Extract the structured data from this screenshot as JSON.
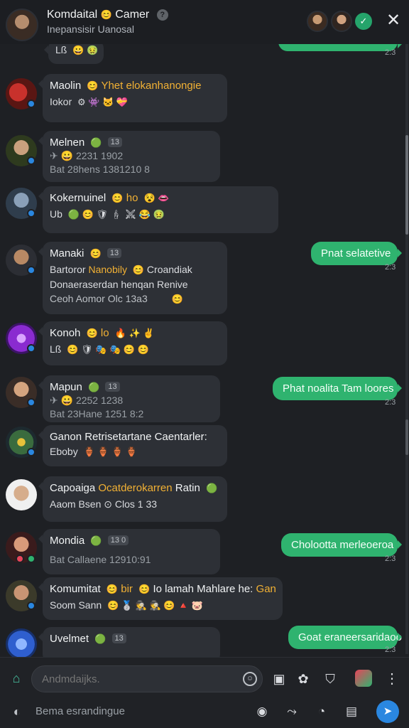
{
  "header": {
    "title": "Komdaital",
    "title_suffix": "Camer",
    "title_emoji": "😊",
    "help_glyph": "?",
    "subtitle": "Inepansisir Uanosal",
    "verified_glyph": "✓",
    "close_glyph": "✕"
  },
  "messages": [
    {
      "name": "",
      "lines": [
        "Lß"
      ],
      "emojis": "😀 🤢"
    },
    {
      "name": "Maolin",
      "highlight": "Yhet elokanhanongie",
      "name_emoji": "😊",
      "lines": [
        "Iokor"
      ],
      "emojis": "⚙ 👾 🐱 💝"
    },
    {
      "name": "Melnen",
      "chip": "13",
      "name_emoji": "🟢",
      "lines": [
        "✈ 😀 2231 1902",
        "Bat 28hens 1381210 8"
      ]
    },
    {
      "name": "Kokernuinel",
      "highlight": "ho",
      "name_emoji": "😊",
      "name_emoji2": "😵 👄",
      "lines": [
        "Ub"
      ],
      "emojis": "🟢 😊 🛡 🕯 ⚔ 😂 🤢"
    },
    {
      "name": "Manaki",
      "chip": "13",
      "name_emoji": "😊",
      "lines": [
        "Bartoror",
        "Donaeraserdan henqan Renive",
        "Ceoh Aomor Olc 13a3"
      ],
      "line1_mid": "Nanobily",
      "line1_end": "Croandiak",
      "line1_emoji": "😊",
      "last_emoji": "😊"
    },
    {
      "name": "Konoh",
      "highlight": "lo",
      "name_emoji": "😊",
      "name_emoji2": "🔥 ✨ ✌",
      "lines": [
        "Lß"
      ],
      "emojis": "😊 🛡 🎭 🎭 😊 😊"
    },
    {
      "name": "Mapun",
      "chip": "13",
      "name_emoji": "🟢",
      "lines": [
        "✈ 😀 2252 1238",
        "Bat 23Hane 1251 8:2"
      ]
    },
    {
      "name": "Ganon Retrisetartane Caentarler:",
      "lines": [
        "Eboby"
      ],
      "emojis": "🏺 🏺 🏺 🏺"
    },
    {
      "name": "Capoaiga",
      "highlight": "Ocatderokarren",
      "name_end": "Ratin",
      "name_emoji": "🟢",
      "lines": [
        "Aaom Bsen ⊙ Clos 1 33"
      ]
    },
    {
      "name": "Mondia",
      "chip": "13 0",
      "name_emoji": "🟢",
      "lines": [
        "Bat Callaene 12910:91"
      ]
    },
    {
      "name": "Komumitat",
      "highlight": "bir",
      "name_end": "Io lamah Mahlare he:",
      "name_end_hl": "Gan",
      "name_emoji": "😊",
      "name_emoji2": "😊",
      "lines": [
        "Soom Sann"
      ],
      "emojis": "😊 🥈 🕵 🕵 😊 🔺 🐷"
    },
    {
      "name": "Uvelmet",
      "chip": "13",
      "name_emoji": "🟢",
      "lines": []
    }
  ],
  "outgoing": [
    {
      "text": "Pnat selatetive",
      "time": "2:3"
    },
    {
      "text": "Phat noalita Tam loores",
      "time": "2:3"
    },
    {
      "text": "Cholootta merleoeroa",
      "time": "2:3"
    },
    {
      "text": "Goat eraneersaridaoo",
      "time": "2:3"
    }
  ],
  "top_out_time": "2:3",
  "composer": {
    "placeholder": "Andmdaijks.",
    "hint": "Bema esrandingue",
    "more_glyph": "⋮",
    "send_glyph": "➤"
  },
  "colors": {
    "background": "#1e2024",
    "bubble_in": "#2d3036",
    "bubble_out": "#2fb36f",
    "accent_send": "#2a87e0",
    "highlight_text": "#f2b134"
  },
  "icons": {
    "home": "home-icon",
    "emoji": "emoji-icon",
    "sticker": "sticker-icon",
    "gif": "gif-icon",
    "shield": "shield-icon",
    "app": "app-icon",
    "more": "more-icon",
    "send": "send-icon"
  }
}
